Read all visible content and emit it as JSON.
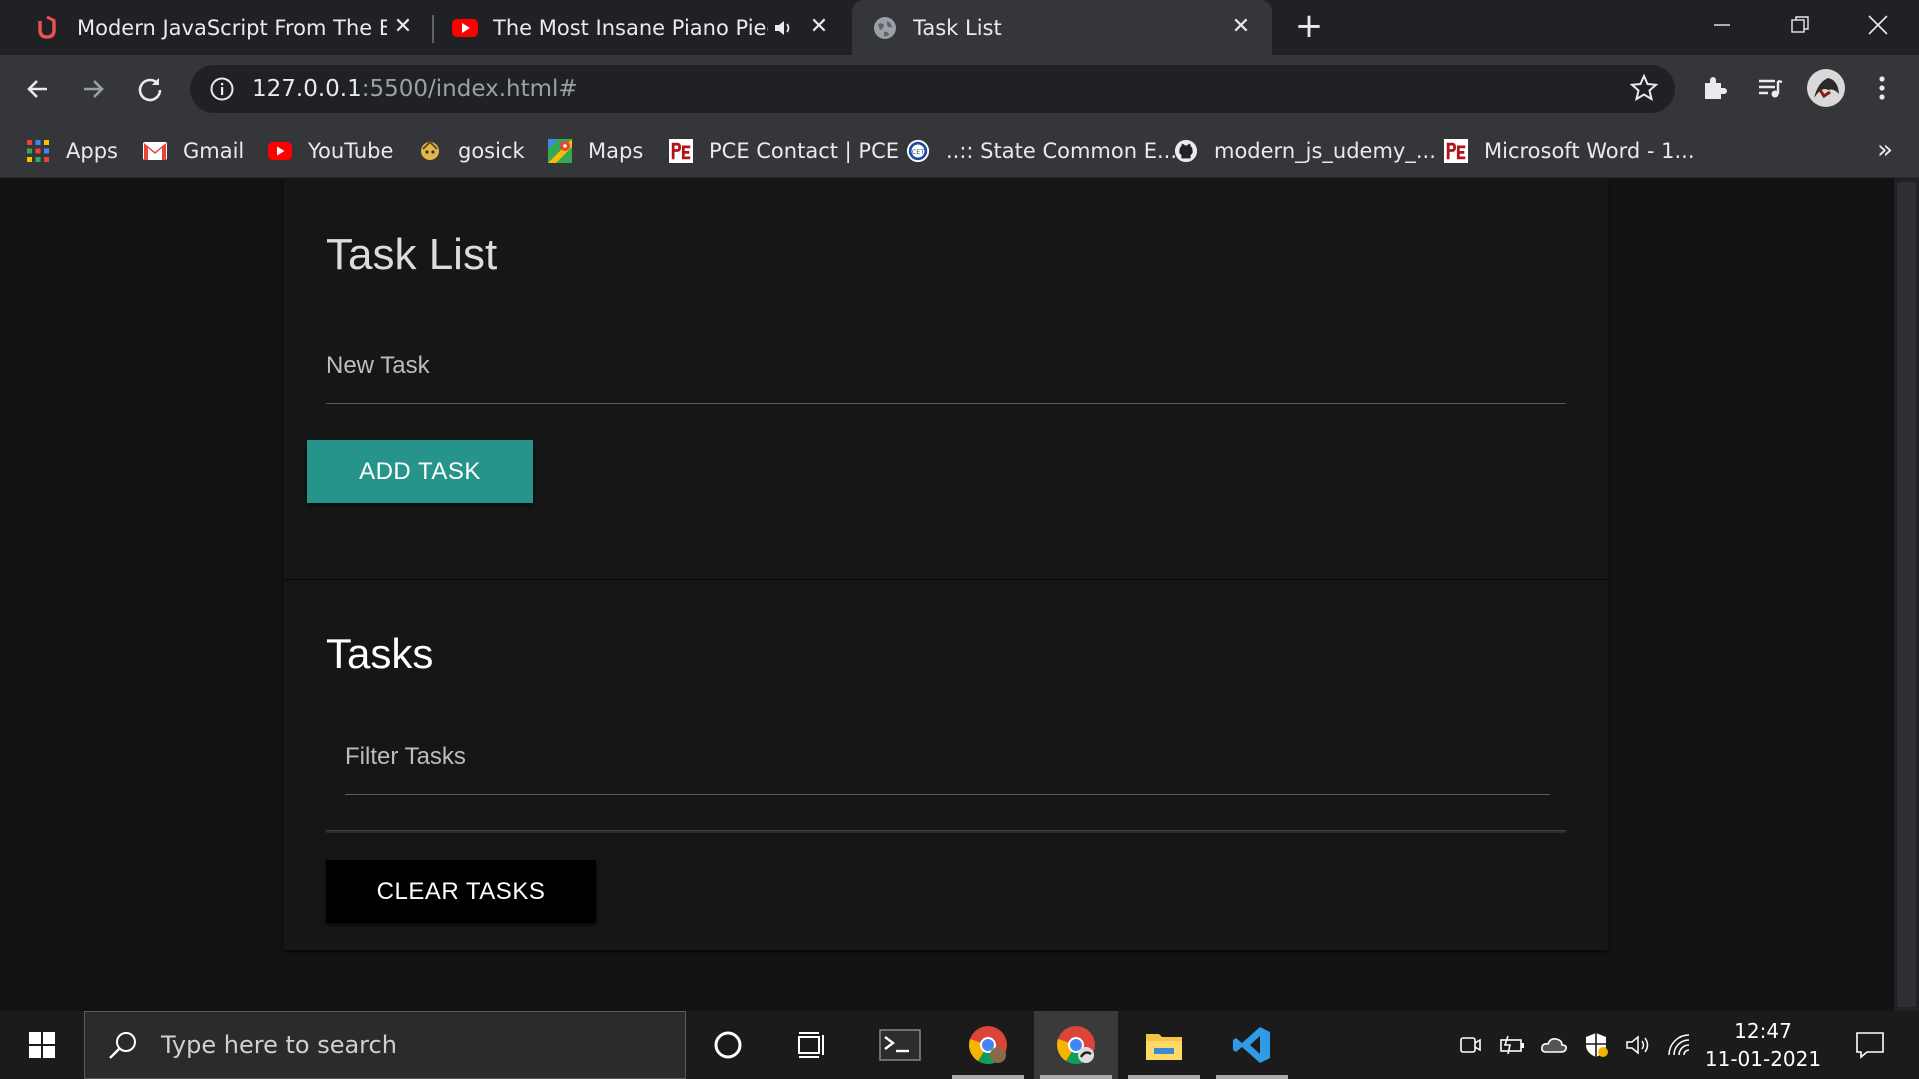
{
  "browser": {
    "tabs": [
      {
        "title": "Modern JavaScript From The Beg",
        "icon": "udemy-icon"
      },
      {
        "title": "The Most Insane Piano Piece",
        "icon": "youtube-icon",
        "audio": true
      },
      {
        "title": "Task List",
        "icon": "globe-icon"
      }
    ],
    "address": {
      "host": "127.0.0.1",
      "path": ":5500/index.html#"
    },
    "bookmarks": [
      {
        "label": "Apps",
        "icon": "apps-grid-icon"
      },
      {
        "label": "Gmail",
        "icon": "gmail-icon"
      },
      {
        "label": "YouTube",
        "icon": "youtube-icon"
      },
      {
        "label": "gosick",
        "icon": "gosick-icon"
      },
      {
        "label": "Maps",
        "icon": "maps-icon"
      },
      {
        "label": "PCE Contact | PCE",
        "icon": "pce-icon"
      },
      {
        "label": "..:: State Common E...",
        "icon": "cet-icon"
      },
      {
        "label": "modern_js_udemy_...",
        "icon": "github-icon"
      },
      {
        "label": "Microsoft Word - 1...",
        "icon": "pce-icon"
      }
    ],
    "bookmarks_overflow": "»"
  },
  "page": {
    "card1": {
      "title": "Task List",
      "new_task_placeholder": "New Task",
      "add_button": "ADD TASK"
    },
    "card2": {
      "title": "Tasks",
      "filter_placeholder": "Filter Tasks",
      "clear_button": "CLEAR TASKS"
    }
  },
  "taskbar": {
    "search_placeholder": "Type here to search",
    "time": "12:47",
    "date": "11-01-2021"
  },
  "colors": {
    "accent_teal": "#26948a",
    "page_bg": "#121212",
    "card_bg": "#161616"
  }
}
